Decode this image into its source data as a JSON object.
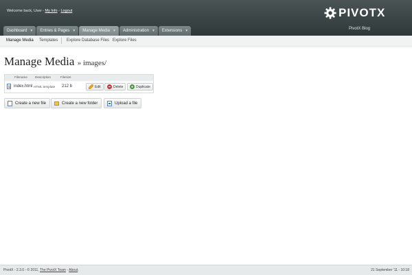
{
  "header": {
    "welcome_prefix": "Welcome back, User - ",
    "my_info": "My Info",
    "separator": " - ",
    "logout": "Logout",
    "logo_text": "PIVOTX",
    "logo_icon": "gear-icon",
    "site_name": "PivotX Blog",
    "colors": {
      "header_bg": "#3b4545"
    }
  },
  "tabs": [
    {
      "label": "Dashboard",
      "active": false
    },
    {
      "label": "Entries & Pages",
      "active": false
    },
    {
      "label": "Manage Media",
      "active": true
    },
    {
      "label": "Administration",
      "active": false
    },
    {
      "label": "Extensions",
      "active": false
    }
  ],
  "subnav": {
    "items": [
      "Manage Media",
      "Templates",
      "Explore Database Files",
      "Explore Files"
    ]
  },
  "page": {
    "title": "Manage Media",
    "crumb": "» images/"
  },
  "table": {
    "headers": [
      "Filename",
      "Description",
      "Filesize"
    ],
    "rows": [
      {
        "filename": "index.html",
        "description": "HTML template",
        "filesize": "212 b",
        "edit": "Edit",
        "delete": "Delete",
        "duplicate": "Duplicate"
      }
    ]
  },
  "actions": {
    "new_file": "Create a new file",
    "new_folder": "Create a new folder",
    "upload": "Upload a file"
  },
  "footer": {
    "version": "PivotX - 2.3.0",
    "sep1": "  -  © 2011, ",
    "team": "The PivotX Team",
    "sep2": " - ",
    "about": "About",
    "dot": ".",
    "timestamp": "21 September '11 - 10:18"
  }
}
